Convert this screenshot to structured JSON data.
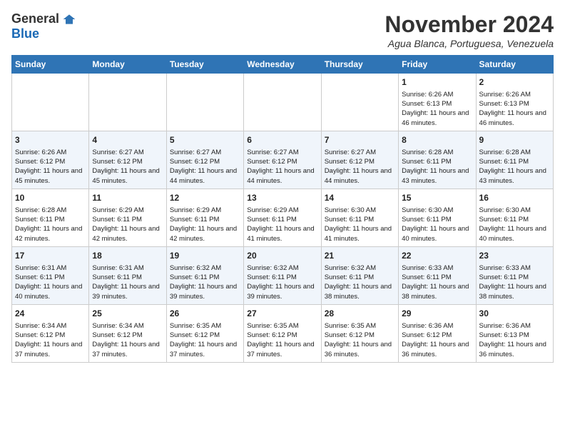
{
  "logo": {
    "general": "General",
    "blue": "Blue"
  },
  "title": "November 2024",
  "location": "Agua Blanca, Portuguesa, Venezuela",
  "headers": [
    "Sunday",
    "Monday",
    "Tuesday",
    "Wednesday",
    "Thursday",
    "Friday",
    "Saturday"
  ],
  "weeks": [
    [
      {
        "day": "",
        "info": ""
      },
      {
        "day": "",
        "info": ""
      },
      {
        "day": "",
        "info": ""
      },
      {
        "day": "",
        "info": ""
      },
      {
        "day": "",
        "info": ""
      },
      {
        "day": "1",
        "info": "Sunrise: 6:26 AM\nSunset: 6:13 PM\nDaylight: 11 hours and 46 minutes."
      },
      {
        "day": "2",
        "info": "Sunrise: 6:26 AM\nSunset: 6:13 PM\nDaylight: 11 hours and 46 minutes."
      }
    ],
    [
      {
        "day": "3",
        "info": "Sunrise: 6:26 AM\nSunset: 6:12 PM\nDaylight: 11 hours and 45 minutes."
      },
      {
        "day": "4",
        "info": "Sunrise: 6:27 AM\nSunset: 6:12 PM\nDaylight: 11 hours and 45 minutes."
      },
      {
        "day": "5",
        "info": "Sunrise: 6:27 AM\nSunset: 6:12 PM\nDaylight: 11 hours and 44 minutes."
      },
      {
        "day": "6",
        "info": "Sunrise: 6:27 AM\nSunset: 6:12 PM\nDaylight: 11 hours and 44 minutes."
      },
      {
        "day": "7",
        "info": "Sunrise: 6:27 AM\nSunset: 6:12 PM\nDaylight: 11 hours and 44 minutes."
      },
      {
        "day": "8",
        "info": "Sunrise: 6:28 AM\nSunset: 6:11 PM\nDaylight: 11 hours and 43 minutes."
      },
      {
        "day": "9",
        "info": "Sunrise: 6:28 AM\nSunset: 6:11 PM\nDaylight: 11 hours and 43 minutes."
      }
    ],
    [
      {
        "day": "10",
        "info": "Sunrise: 6:28 AM\nSunset: 6:11 PM\nDaylight: 11 hours and 42 minutes."
      },
      {
        "day": "11",
        "info": "Sunrise: 6:29 AM\nSunset: 6:11 PM\nDaylight: 11 hours and 42 minutes."
      },
      {
        "day": "12",
        "info": "Sunrise: 6:29 AM\nSunset: 6:11 PM\nDaylight: 11 hours and 42 minutes."
      },
      {
        "day": "13",
        "info": "Sunrise: 6:29 AM\nSunset: 6:11 PM\nDaylight: 11 hours and 41 minutes."
      },
      {
        "day": "14",
        "info": "Sunrise: 6:30 AM\nSunset: 6:11 PM\nDaylight: 11 hours and 41 minutes."
      },
      {
        "day": "15",
        "info": "Sunrise: 6:30 AM\nSunset: 6:11 PM\nDaylight: 11 hours and 40 minutes."
      },
      {
        "day": "16",
        "info": "Sunrise: 6:30 AM\nSunset: 6:11 PM\nDaylight: 11 hours and 40 minutes."
      }
    ],
    [
      {
        "day": "17",
        "info": "Sunrise: 6:31 AM\nSunset: 6:11 PM\nDaylight: 11 hours and 40 minutes."
      },
      {
        "day": "18",
        "info": "Sunrise: 6:31 AM\nSunset: 6:11 PM\nDaylight: 11 hours and 39 minutes."
      },
      {
        "day": "19",
        "info": "Sunrise: 6:32 AM\nSunset: 6:11 PM\nDaylight: 11 hours and 39 minutes."
      },
      {
        "day": "20",
        "info": "Sunrise: 6:32 AM\nSunset: 6:11 PM\nDaylight: 11 hours and 39 minutes."
      },
      {
        "day": "21",
        "info": "Sunrise: 6:32 AM\nSunset: 6:11 PM\nDaylight: 11 hours and 38 minutes."
      },
      {
        "day": "22",
        "info": "Sunrise: 6:33 AM\nSunset: 6:11 PM\nDaylight: 11 hours and 38 minutes."
      },
      {
        "day": "23",
        "info": "Sunrise: 6:33 AM\nSunset: 6:11 PM\nDaylight: 11 hours and 38 minutes."
      }
    ],
    [
      {
        "day": "24",
        "info": "Sunrise: 6:34 AM\nSunset: 6:12 PM\nDaylight: 11 hours and 37 minutes."
      },
      {
        "day": "25",
        "info": "Sunrise: 6:34 AM\nSunset: 6:12 PM\nDaylight: 11 hours and 37 minutes."
      },
      {
        "day": "26",
        "info": "Sunrise: 6:35 AM\nSunset: 6:12 PM\nDaylight: 11 hours and 37 minutes."
      },
      {
        "day": "27",
        "info": "Sunrise: 6:35 AM\nSunset: 6:12 PM\nDaylight: 11 hours and 37 minutes."
      },
      {
        "day": "28",
        "info": "Sunrise: 6:35 AM\nSunset: 6:12 PM\nDaylight: 11 hours and 36 minutes."
      },
      {
        "day": "29",
        "info": "Sunrise: 6:36 AM\nSunset: 6:12 PM\nDaylight: 11 hours and 36 minutes."
      },
      {
        "day": "30",
        "info": "Sunrise: 6:36 AM\nSunset: 6:13 PM\nDaylight: 11 hours and 36 minutes."
      }
    ]
  ]
}
